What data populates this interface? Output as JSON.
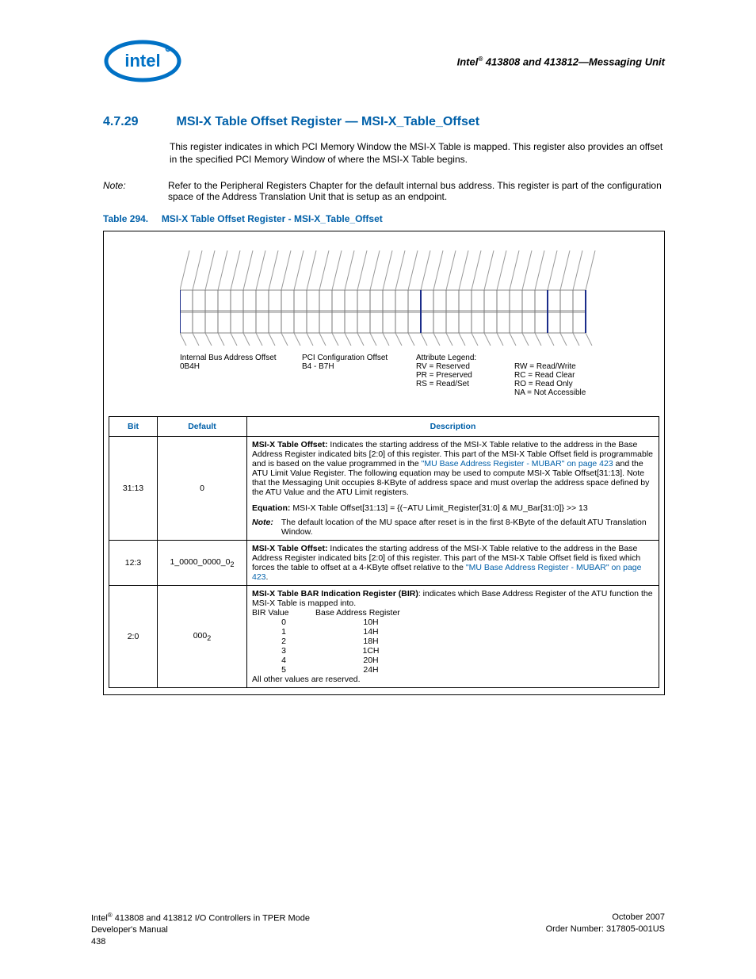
{
  "header": {
    "brand": "intel",
    "doc_title": "Intel® 413808 and 413812—Messaging Unit"
  },
  "section": {
    "number": "4.7.29",
    "title": "MSI-X Table Offset Register — MSI-X_Table_Offset",
    "intro": "This register indicates in which PCI Memory Window the MSI-X Table is mapped. This register also provides an offset in the specified PCI Memory Window of where the MSI-X Table begins.",
    "note_label": "Note:",
    "note_text": "Refer to the Peripheral Registers Chapter for the default internal bus address. This register is part of the configuration space of the Address Translation Unit that is setup as an endpoint."
  },
  "table_caption": {
    "number": "Table 294.",
    "title": "MSI-X Table Offset Register - MSI-X_Table_Offset"
  },
  "diagram": {
    "internal_bus_label": "Internal Bus Address Offset",
    "internal_bus_value": "0B4H",
    "pci_offset_label": "PCI Configuration Offset",
    "pci_offset_value": "B4 - B7H",
    "attr_legend_label": "Attribute Legend:",
    "attrs": {
      "rv": "RV = Reserved",
      "pr": "PR = Preserved",
      "rs": "RS = Read/Set",
      "rw": "RW = Read/Write",
      "rc": "RC = Read Clear",
      "ro": "RO = Read Only",
      "na": "NA = Not Accessible"
    }
  },
  "reg_table": {
    "headers": {
      "bit": "Bit",
      "default": "Default",
      "desc": "Description"
    },
    "rows": [
      {
        "bit": "31:13",
        "default": "0",
        "desc_bold": "MSI-X Table Offset:",
        "desc_1": " Indicates the starting address of the MSI-X Table relative to the address in the Base Address Register indicated bits [2:0] of this register. This part of the MSI-X Table Offset field is programmable and is based on the value programmed in the ",
        "link_1": "\"MU Base Address Register - MUBAR\" on page 423",
        "desc_2": " and the ATU Limit Value Register. The following equation may be used to compute MSI-X Table Offset[31:13]. Note that the Messaging Unit occupies 8-KByte of address space and must overlap the address space defined by the ATU Value and the ATU Limit registers.",
        "equation_label": "Equation:",
        "equation": " MSI-X Table Offset[31:13] = {(~ATU Limit_Register[31:0] & MU_Bar[31:0]} >> 13",
        "subnote_label": "Note:",
        "subnote_text": "The default location of the MU space after reset is in the first 8-KByte of the default ATU Translation Window."
      },
      {
        "bit": "12:3",
        "default_pre": "1_0000_0000_0",
        "default_sub": "2",
        "desc_bold": "MSI-X Table Offset:",
        "desc_1": " Indicates the starting address of the MSI-X Table relative to the address in the Base Address Register indicated bits [2:0] of this register. This part of the MSI-X Table Offset field is fixed which forces the table to offset at a 4-KByte offset relative to the ",
        "link_1": "\"MU Base Address Register - MUBAR\" on page 423",
        "desc_2": "."
      },
      {
        "bit": "2:0",
        "default_pre": "000",
        "default_sub": "2",
        "desc_bold": "MSI-X Table BAR Indication Register (BIR)",
        "desc_1": ": indicates which Base Address Register of the ATU function the MSI-X Table is mapped into.",
        "bir_header_val": "BIR Value",
        "bir_header_bar": "Base Address Register",
        "bir_rows": [
          {
            "v": "0",
            "b": "10H"
          },
          {
            "v": "1",
            "b": "14H"
          },
          {
            "v": "2",
            "b": "18H"
          },
          {
            "v": "3",
            "b": "1CH"
          },
          {
            "v": "4",
            "b": "20H"
          },
          {
            "v": "5",
            "b": "24H"
          }
        ],
        "reserved_text": "All other values are reserved."
      }
    ]
  },
  "footer": {
    "left_1": "Intel® 413808 and 413812 I/O Controllers in TPER Mode",
    "left_2": "Developer's Manual",
    "left_3": "438",
    "right_1": "October 2007",
    "right_2": "Order Number: 317805-001US"
  }
}
